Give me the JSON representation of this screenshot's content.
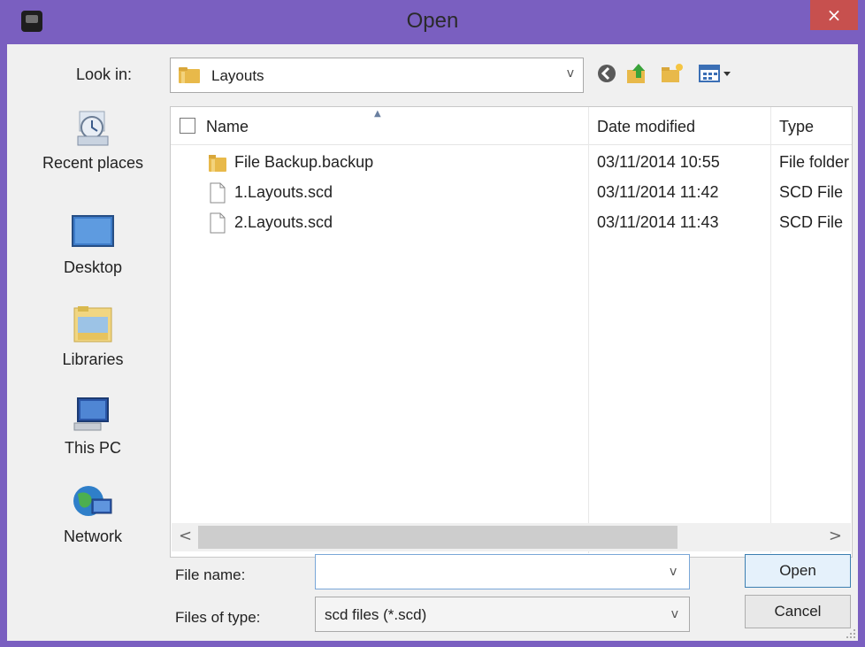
{
  "window": {
    "title": "Open",
    "close_glyph": "×"
  },
  "lookin": {
    "label": "Look in:",
    "value": "Layouts",
    "arrow": "v"
  },
  "toolbar": {
    "icons": [
      "back-icon",
      "up-folder-icon",
      "new-folder-icon",
      "view-menu-icon"
    ]
  },
  "places": [
    {
      "label": "Recent places",
      "icon": "recent-places-icon"
    },
    {
      "label": "Desktop",
      "icon": "desktop-icon"
    },
    {
      "label": "Libraries",
      "icon": "libraries-icon"
    },
    {
      "label": "This PC",
      "icon": "this-pc-icon"
    },
    {
      "label": "Network",
      "icon": "network-icon"
    }
  ],
  "columns": {
    "name": "Name",
    "date": "Date modified",
    "type": "Type"
  },
  "files": [
    {
      "name": "File Backup.backup",
      "date": "03/11/2014 10:55",
      "type": "File folder",
      "icon": "folder-icon"
    },
    {
      "name": "1.Layouts.scd",
      "date": "03/11/2014 11:42",
      "type": "SCD File",
      "icon": "file-icon"
    },
    {
      "name": "2.Layouts.scd",
      "date": "03/11/2014 11:43",
      "type": "SCD File",
      "icon": "file-icon"
    }
  ],
  "scroll": {
    "left": "<",
    "right": ">"
  },
  "filename": {
    "label": "File name:",
    "value": "",
    "arrow": "v"
  },
  "filetype": {
    "label": "Files of type:",
    "value": "scd files (*.scd)",
    "arrow": "v"
  },
  "buttons": {
    "open": "Open",
    "cancel": "Cancel"
  },
  "colors": {
    "titlebar": "#7a5fc0",
    "close": "#c7504e",
    "accent": "#3c7fb1"
  }
}
